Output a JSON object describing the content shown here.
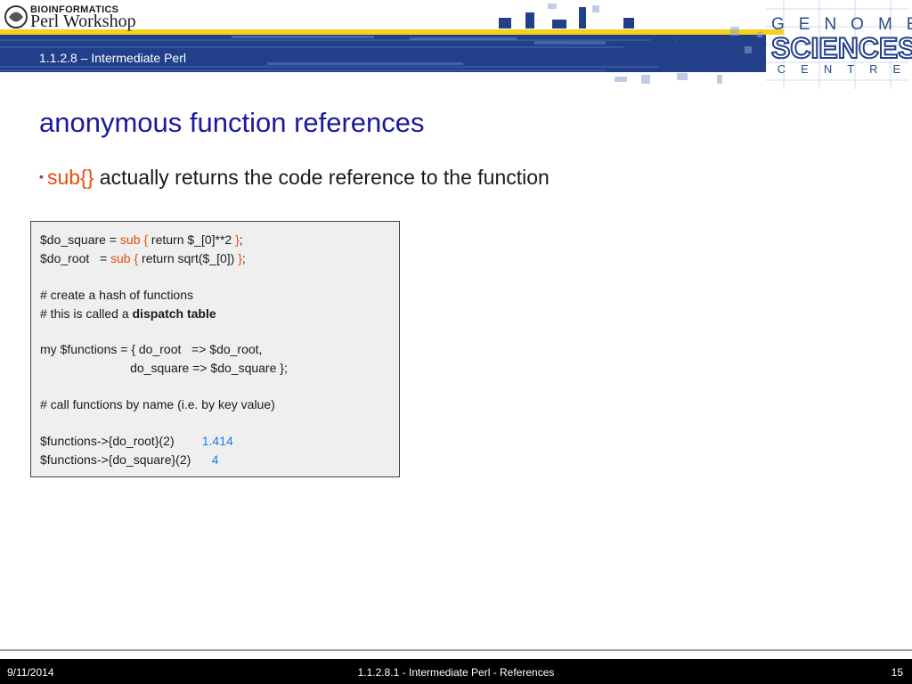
{
  "header": {
    "logo_line1": "BIOINFORMATICS",
    "logo_line2": "Perl Workshop",
    "section_label": "1.1.2.8 – Intermediate Perl",
    "gsc_line1": "GENOME",
    "gsc_line2": "SCIENCES",
    "gsc_line3": "CENTRE"
  },
  "slide": {
    "title": "anonymous function references",
    "bullet_code": "sub{}",
    "bullet_text": " actually returns the code reference to the function"
  },
  "code": {
    "l1_a": "$do_square = ",
    "l1_b": "sub {",
    "l1_c": " return $_[0]**2 ",
    "l1_d": "}",
    "l1_e": ";",
    "l2_a": "$do_root   = ",
    "l2_b": "sub {",
    "l2_c": " return sqrt($_[0]) ",
    "l2_d": "}",
    "l2_e": ";",
    "l3": "# create a hash of functions",
    "l4_a": "# this is called a ",
    "l4_b": "dispatch table",
    "l5": "my $functions = { do_root   => $do_root,",
    "l6": "                          do_square => $do_square };",
    "l7": "# call functions by name (i.e. by key value)",
    "l8_a": "$functions->{do_root}(2)        ",
    "l8_b": "1.414",
    "l9_a": "$functions->{do_square}(2)      ",
    "l9_b": "4"
  },
  "footer": {
    "date": "9/11/2014",
    "center": "1.1.2.8.1 - Intermediate Perl - References",
    "page": "15"
  },
  "colors": {
    "title": "#1a1a9c",
    "code_keyword": "#e84a0c",
    "code_comment": "#1580e0",
    "banner_blue": "#223f8a",
    "banner_yellow": "#f2d21b"
  }
}
